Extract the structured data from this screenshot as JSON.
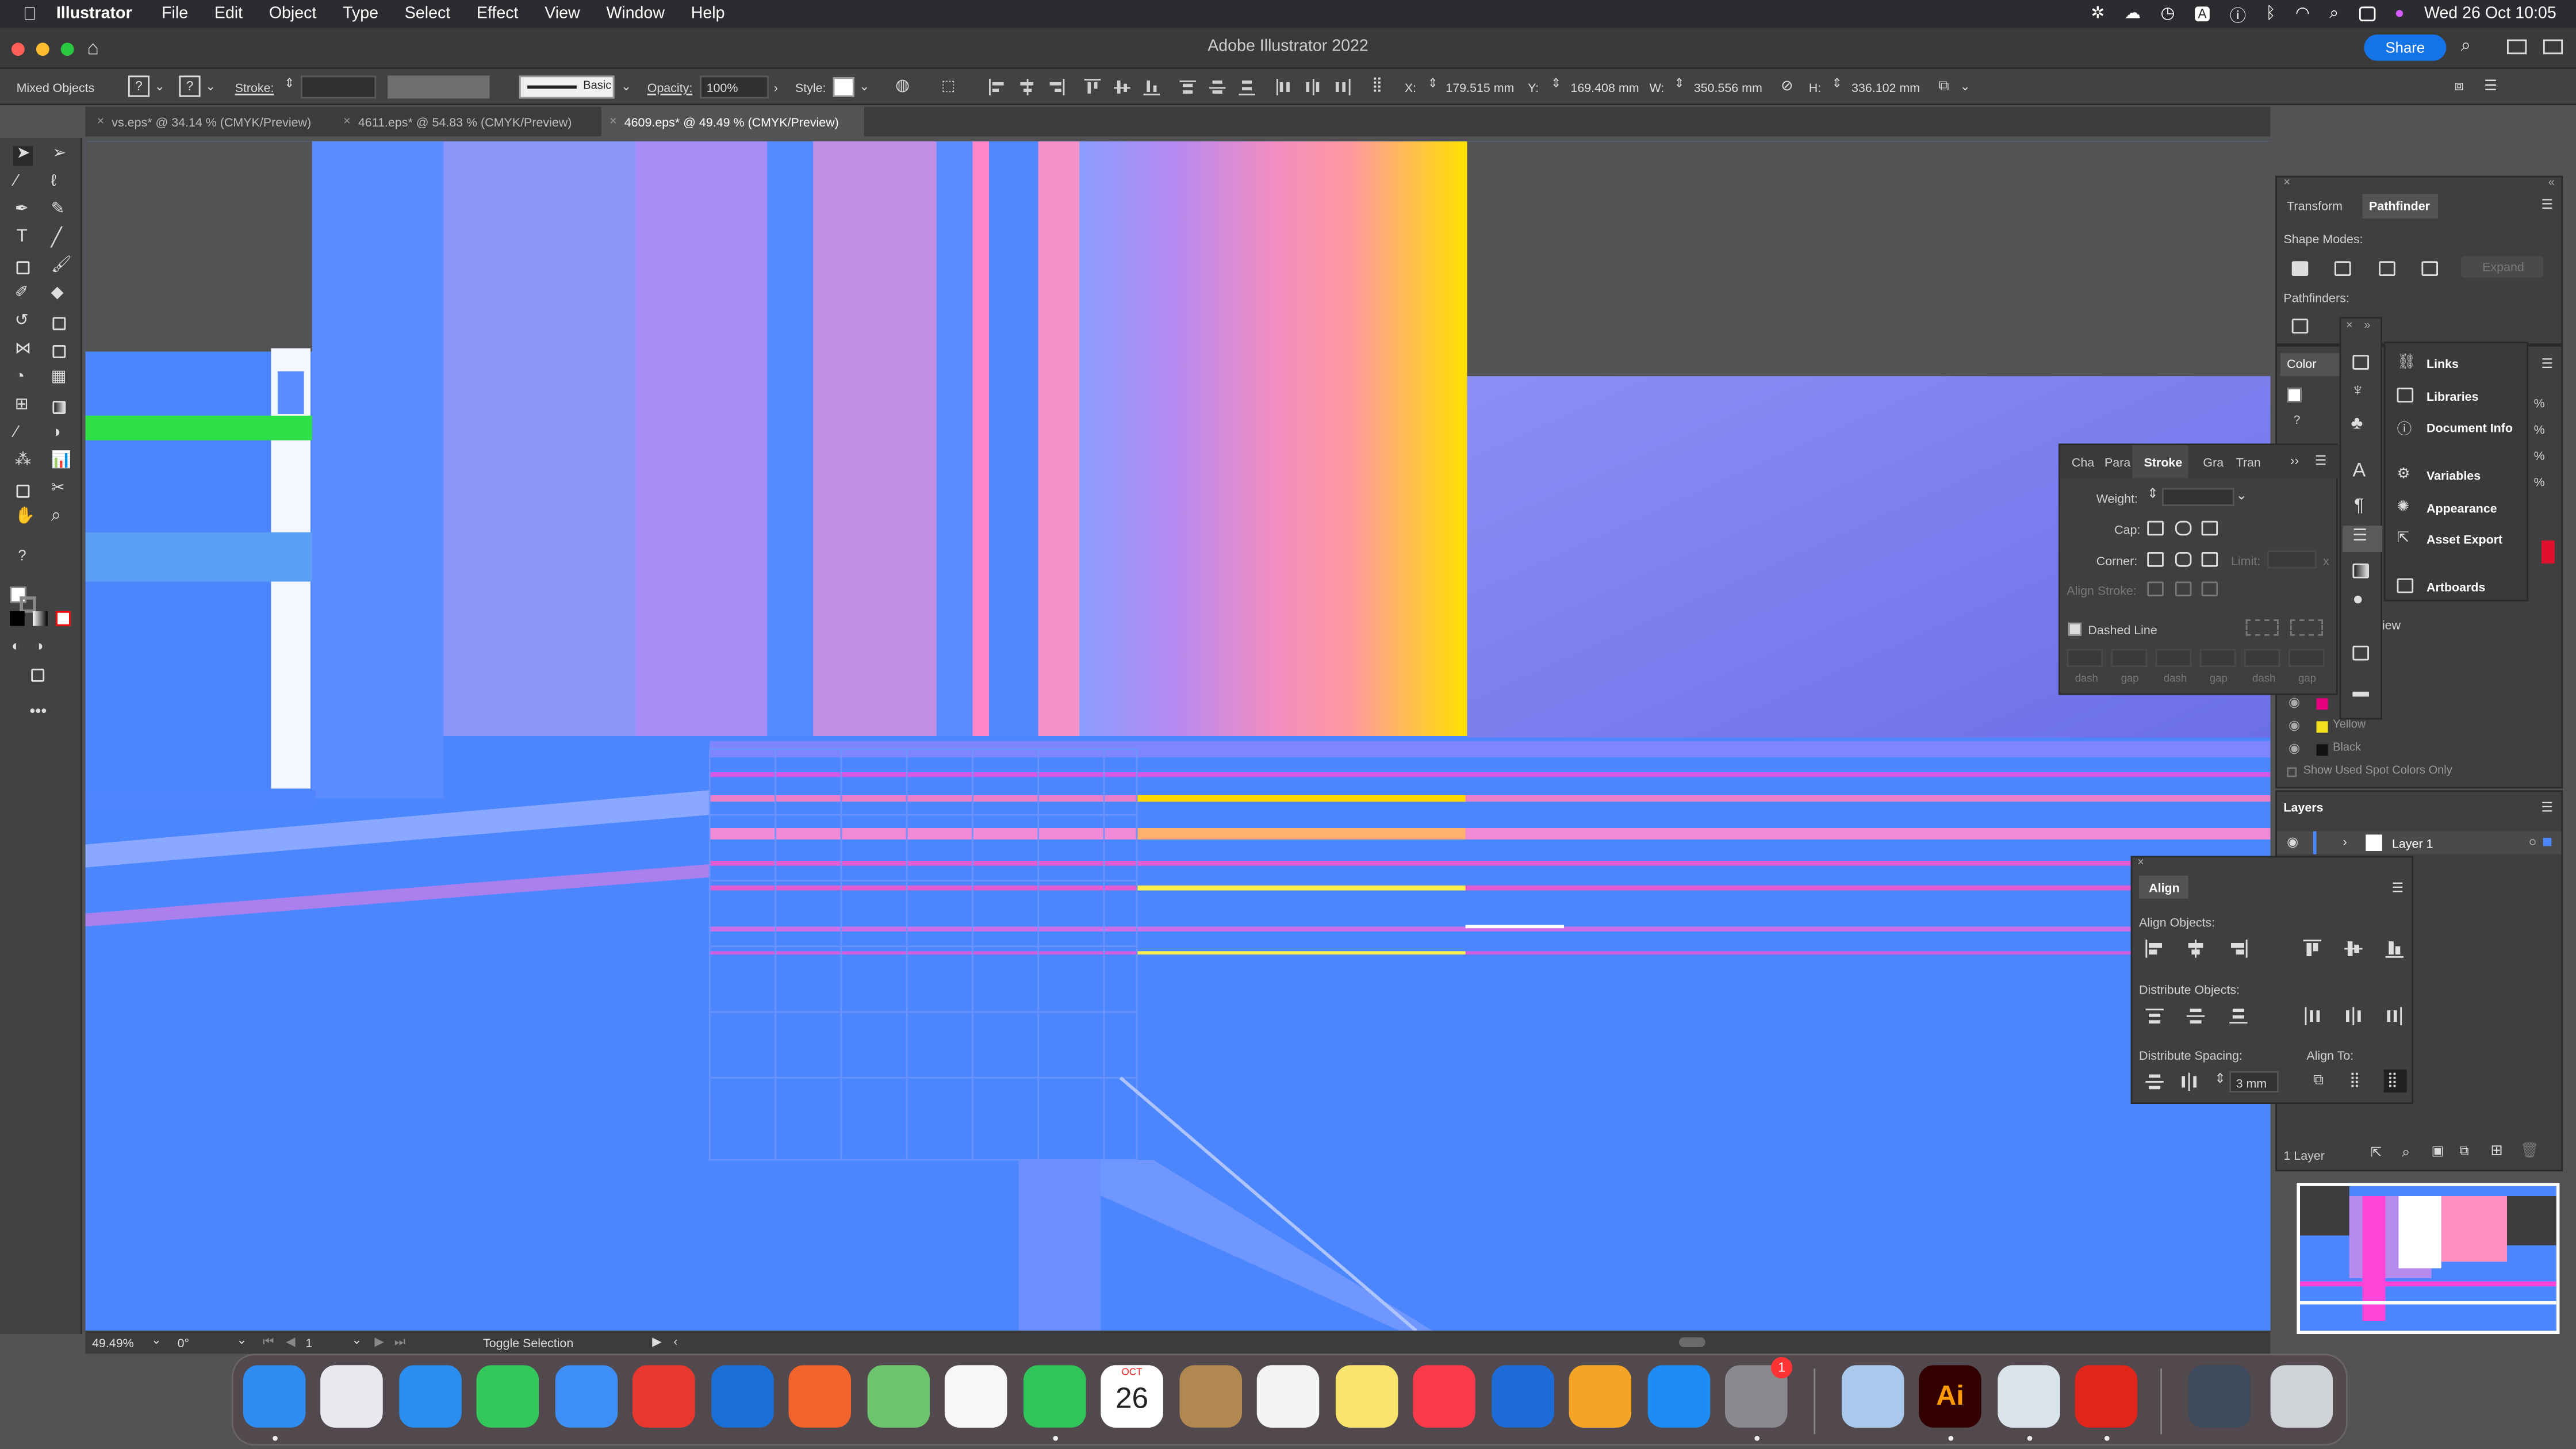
{
  "menubar": {
    "app": "Illustrator",
    "items": [
      "File",
      "Edit",
      "Object",
      "Type",
      "Select",
      "Effect",
      "View",
      "Window",
      "Help"
    ],
    "clock": "Wed 26 Oct  10:05",
    "status_icon_letter": "A"
  },
  "titlebar": {
    "title": "Adobe Illustrator 2022",
    "share_label": "Share"
  },
  "control": {
    "selection_label": "Mixed Objects",
    "fill_unknown": "?",
    "stroke_unknown": "?",
    "stroke_label": "Stroke:",
    "brush_label": "Basic",
    "opacity_label": "Opacity:",
    "opacity_value": "100%",
    "style_label": "Style:",
    "x_label": "X:",
    "x_value": "179.515 mm",
    "y_label": "Y:",
    "y_value": "169.408 mm",
    "w_label": "W:",
    "w_value": "350.556 mm",
    "h_label": "H:",
    "h_value": "336.102 mm"
  },
  "tabs": [
    {
      "label": "vs.eps* @ 34.14 % (CMYK/Preview)"
    },
    {
      "label": "4611.eps* @ 54.83 % (CMYK/Preview)"
    },
    {
      "label": "4609.eps* @ 49.49 % (CMYK/Preview)"
    }
  ],
  "status": {
    "zoom": "49.49%",
    "rotation": "0°",
    "artboard_number": "1",
    "tool_hint": "Toggle Selection"
  },
  "pathfinder_panel": {
    "tabs": [
      "Transform",
      "Pathfinder"
    ],
    "shape_modes_label": "Shape Modes:",
    "expand_label": "Expand",
    "pathfinders_label": "Pathfinders:"
  },
  "color_panel": {
    "tab": "Color",
    "unknown": "?",
    "percent_sign": "%",
    "swatches": [
      {
        "name": "Yellow",
        "color": "#f4e01c"
      },
      {
        "name": "Black",
        "color": "#111111"
      }
    ],
    "show_used_label": "Show Used Spot Colors Only",
    "view_fragment": "iew"
  },
  "stroke_panel": {
    "tabs": [
      "Cha",
      "Para",
      "Stroke",
      "Gra",
      "Tran"
    ],
    "weight_label": "Weight:",
    "cap_label": "Cap:",
    "corner_label": "Corner:",
    "limit_label": "Limit:",
    "limit_unit": "x",
    "align_label": "Align Stroke:",
    "dashed_label": "Dashed Line",
    "dash_fields": [
      "dash",
      "gap",
      "dash",
      "gap",
      "dash",
      "gap"
    ]
  },
  "flyout_menu": {
    "items": [
      "Links",
      "Libraries",
      "Document Info",
      "Variables",
      "Appearance",
      "Asset Export",
      "Artboards"
    ]
  },
  "layers_panel": {
    "title": "Layers",
    "layer_name": "Layer 1",
    "count_label": "1 Layer"
  },
  "align_panel": {
    "title": "Align",
    "align_objects": "Align Objects:",
    "distribute_objects": "Distribute Objects:",
    "distribute_spacing": "Distribute Spacing:",
    "align_to": "Align To:",
    "spacing_value": "3 mm"
  },
  "dock": {
    "calendar_month": "OCT",
    "calendar_day": "26",
    "badge_count": "1",
    "ai_label": "Ai",
    "apps": [
      {
        "name": "finder-icon",
        "color": "#2f8cf0"
      },
      {
        "name": "launchpad-icon",
        "color": "#e8e8ee"
      },
      {
        "name": "safari-icon",
        "color": "#2a8ef0"
      },
      {
        "name": "messages-icon",
        "color": "#34c759"
      },
      {
        "name": "mail-icon",
        "color": "#3d8ff5"
      },
      {
        "name": "anydesk-icon",
        "color": "#e8372c"
      },
      {
        "name": "testflight-icon",
        "color": "#1a6fd6"
      },
      {
        "name": "firefox-icon",
        "color": "#f2632b"
      },
      {
        "name": "maps-icon",
        "color": "#6cc46c"
      },
      {
        "name": "photos-icon",
        "color": "#f7f7f7"
      },
      {
        "name": "facetime-icon",
        "color": "#30c45a"
      },
      {
        "name": "calendar-icon",
        "color": "#ffffff"
      },
      {
        "name": "contacts-icon",
        "color": "#b08850"
      },
      {
        "name": "reminders-icon",
        "color": "#f4f4f4"
      },
      {
        "name": "notes-icon",
        "color": "#f8e36b"
      },
      {
        "name": "music-icon",
        "color": "#f93a4b"
      },
      {
        "name": "keynote-icon",
        "color": "#1d6bd6"
      },
      {
        "name": "pages-icon",
        "color": "#f5a425"
      },
      {
        "name": "app-store-icon",
        "color": "#1e8cf5"
      },
      {
        "name": "system-preferences-icon",
        "color": "#8a8a8e"
      },
      {
        "name": "preview-icon",
        "color": "#a9c9ec"
      },
      {
        "name": "illustrator-icon",
        "color": "#330000"
      },
      {
        "name": "blank-app-icon",
        "color": "#d9e4ea"
      },
      {
        "name": "acrobat-icon",
        "color": "#e1251b"
      },
      {
        "name": "downloads-stack-icon",
        "color": "#3c4a5c"
      },
      {
        "name": "trash-icon",
        "color": "#cfd2d6"
      }
    ]
  }
}
